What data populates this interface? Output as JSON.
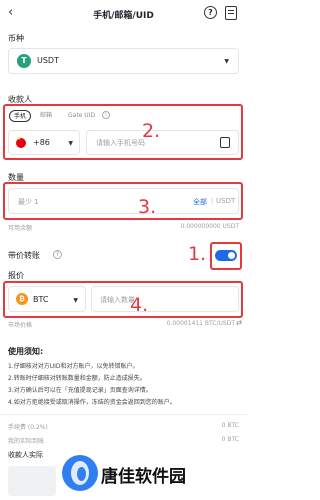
{
  "header": {
    "title": "手机/邮箱/UID"
  },
  "currency": {
    "section_label": "币种",
    "selected": "USDT",
    "coin_symbol": "T"
  },
  "payee": {
    "section_label": "收款人",
    "tabs": [
      {
        "label": "手机",
        "active": true
      },
      {
        "label": "邮箱",
        "active": false
      },
      {
        "label": "Gate UID",
        "active": false
      }
    ],
    "country_code": "+86",
    "phone_placeholder": "请输入手机号码"
  },
  "amount": {
    "section_label": "数量",
    "placeholder": "最少 1",
    "all_label": "全部",
    "unit": "USDT",
    "available_label": "可用余额",
    "available_value": "0.000000000 USDT"
  },
  "priced_transfer": {
    "label": "带价转账",
    "enabled": true
  },
  "quote": {
    "section_label": "报价",
    "coin": "BTC",
    "coin_symbol": "₿",
    "price_placeholder": "请输入数量",
    "market_label": "市场价格",
    "market_value": "0.00001411 BTC/USDT",
    "market_icon": "swap-icon"
  },
  "notice": {
    "title": "使用须知:",
    "items": [
      "1.仔细核对对方UID和对方账户，以免转错账户。",
      "2.转账时仔细核对转账数量和金额，防止造成损失。",
      "3.对方确认后可以在「充值提现记录」页面查询详情。",
      "4.如对方拒绝接受或取消操作，冻结的资金会返回到您的账户。"
    ]
  },
  "summary": {
    "fee_label": "手续费 (0.2%)",
    "fee_value": "0 BTC",
    "actual_label": "我的实际到账",
    "actual_value": "0 BTC",
    "receive_label": "收款人实际"
  },
  "annotations": {
    "one": "1.",
    "two": "2.",
    "three": "3.",
    "four": "4.",
    "color": "#e6393d"
  },
  "watermark": {
    "text": "唐佳软件园"
  }
}
